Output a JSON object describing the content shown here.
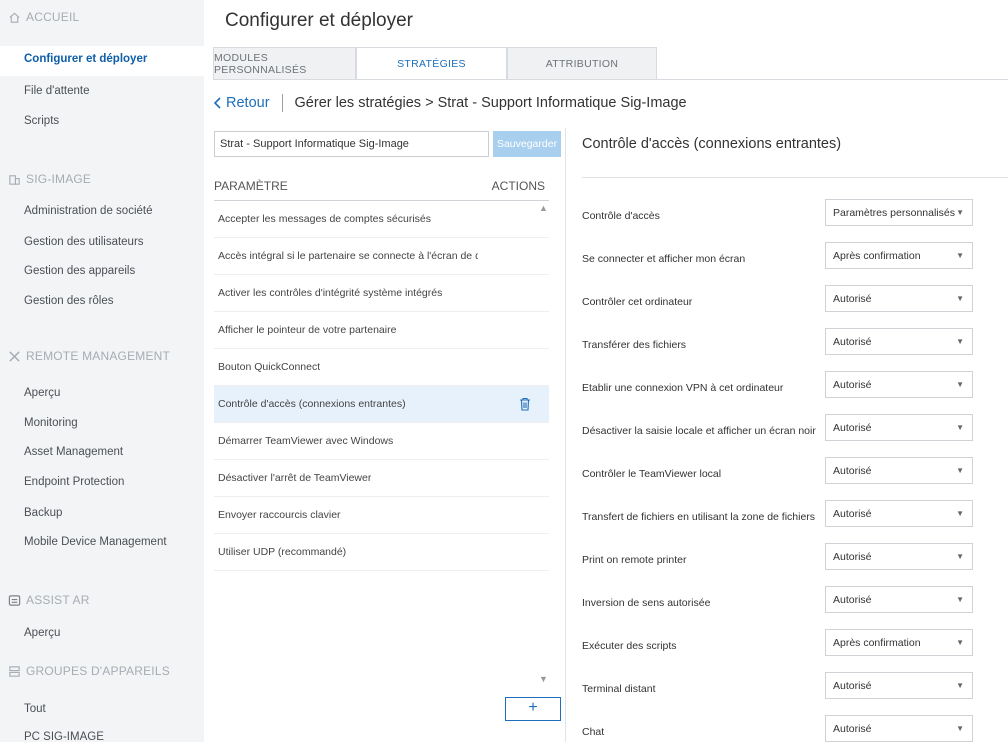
{
  "sidebar": {
    "sections": [
      {
        "title": "ACCUEIL",
        "icon": "home-icon",
        "items": [
          "Configurer et déployer",
          "File d'attente",
          "Scripts"
        ]
      },
      {
        "title": "SIG-IMAGE",
        "icon": "building-icon",
        "items": [
          "Administration de société",
          "Gestion des utilisateurs",
          "Gestion des appareils",
          "Gestion des rôles"
        ]
      },
      {
        "title": "REMOTE MANAGEMENT",
        "icon": "crossed-tools-icon",
        "items": [
          "Aperçu",
          "Monitoring",
          "Asset Management",
          "Endpoint Protection",
          "Backup",
          "Mobile Device Management"
        ]
      },
      {
        "title": "ASSIST AR",
        "icon": "headset-icon",
        "items": [
          "Aperçu"
        ]
      },
      {
        "title": "GROUPES D'APPAREILS",
        "icon": "group-icon",
        "items": [
          "Tout",
          "PC SIG-IMAGE"
        ]
      }
    ],
    "active_item": "Configurer et déployer"
  },
  "main": {
    "title": "Configurer et déployer",
    "tabs": [
      {
        "label": "MODULES PERSONNALISÉS",
        "active": false
      },
      {
        "label": "STRATÉGIES",
        "active": true
      },
      {
        "label": "ATTRIBUTION",
        "active": false
      }
    ],
    "breadcrumb": {
      "back": "Retour",
      "path": "Gérer les stratégies > Strat - Support Informatique Sig-Image"
    }
  },
  "policy": {
    "name_value": "Strat - Support Informatique Sig-Image",
    "save_label": "Sauvegarder",
    "col_param": "PARAMÈTRE",
    "col_actions": "ACTIONS",
    "add_label": "+",
    "params": [
      "Accepter les messages de comptes sécurisés",
      "Accès intégral si le partenaire se connecte à l'écran de démarrage",
      "Activer les contrôles d'intégrité système intégrés",
      "Afficher le pointeur de votre partenaire",
      "Bouton QuickConnect",
      "Contrôle d'accès (connexions entrantes)",
      "Démarrer TeamViewer avec Windows",
      "Désactiver l'arrêt de TeamViewer",
      "Envoyer raccourcis clavier",
      "Utiliser UDP (recommandé)"
    ],
    "selected_param": "Contrôle d'accès (connexions entrantes)"
  },
  "detail": {
    "title": "Contrôle d'accès (connexions entrantes)",
    "settings": [
      {
        "label": "Contrôle d'accès",
        "value": "Paramètres personnalisés"
      },
      {
        "label": "Se connecter et afficher mon écran",
        "value": "Après confirmation"
      },
      {
        "label": "Contrôler cet ordinateur",
        "value": "Autorisé"
      },
      {
        "label": "Transférer des fichiers",
        "value": "Autorisé"
      },
      {
        "label": "Etablir une connexion VPN à cet ordinateur",
        "value": "Autorisé"
      },
      {
        "label": "Désactiver la saisie locale et afficher un écran noir",
        "value": "Autorisé"
      },
      {
        "label": "Contrôler le TeamViewer local",
        "value": "Autorisé"
      },
      {
        "label": "Transfert de fichiers en utilisant la zone de fichiers",
        "value": "Autorisé"
      },
      {
        "label": "Print on remote printer",
        "value": "Autorisé"
      },
      {
        "label": "Inversion de sens autorisée",
        "value": "Autorisé"
      },
      {
        "label": "Exécuter des scripts",
        "value": "Après confirmation"
      },
      {
        "label": "Terminal distant",
        "value": "Autorisé"
      },
      {
        "label": "Chat",
        "value": "Autorisé"
      }
    ]
  },
  "colors": {
    "accent": "#1d6fbb",
    "sidebar_bg": "#f3f4f6",
    "selected_row": "#e7f1fb",
    "save_button": "#a9cfee"
  }
}
